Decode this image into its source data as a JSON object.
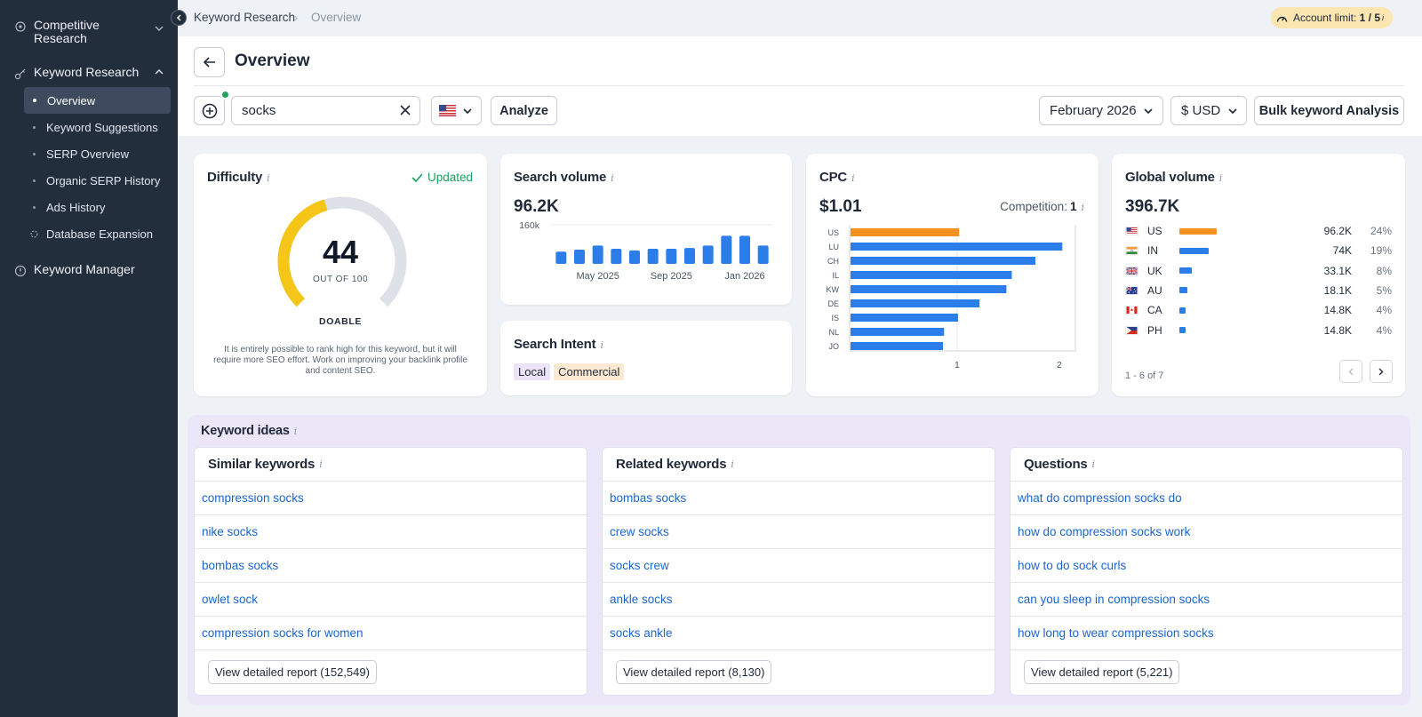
{
  "sidebar": {
    "sections": [
      {
        "label": "Competitive Research",
        "icon": "target-icon"
      },
      {
        "label": "Keyword Research",
        "icon": "key-icon"
      },
      {
        "label": "Keyword Manager",
        "icon": "info-circle-icon"
      }
    ],
    "items": [
      {
        "label": "Overview",
        "active": true
      },
      {
        "label": "Keyword Suggestions"
      },
      {
        "label": "SERP Overview"
      },
      {
        "label": "Organic SERP History"
      },
      {
        "label": "Ads History"
      },
      {
        "label": "Database Expansion"
      }
    ]
  },
  "breadcrumb": {
    "root": "Keyword Research",
    "current": "Overview"
  },
  "account": {
    "label": "Account limit:",
    "value": "1 / 5",
    "info": "i"
  },
  "header": {
    "title": "Overview",
    "search_value": "socks",
    "country": "US",
    "analyze_label": "Analyze",
    "month": "February 2026",
    "currency": "$ USD",
    "bulk_label": "Bulk keyword Analysis"
  },
  "difficulty": {
    "title": "Difficulty",
    "status": "Updated",
    "value": "44",
    "score": 44,
    "out_of": "OUT OF 100",
    "level": "DOABLE",
    "description": "It is entirely possible to rank high for this keyword, but it will require more SEO effort. Work on improving your backlink profile and content SEO."
  },
  "search_volume": {
    "title": "Search volume",
    "value": "96.2K",
    "y_tick": "160k",
    "x_ticks": [
      "May 2025",
      "Sep 2025",
      "Jan 2026"
    ]
  },
  "search_intent": {
    "title": "Search Intent",
    "badges": [
      "Local",
      "Commercial"
    ]
  },
  "cpc": {
    "title": "CPC",
    "value": "$1.01",
    "competition_label": "Competition:",
    "competition_value": "1",
    "x_ticks": [
      "1",
      "2"
    ]
  },
  "global_volume": {
    "title": "Global volume",
    "value": "396.7K",
    "rows": [
      {
        "code": "US",
        "volume": "96.2K",
        "share": "24%",
        "frac": 0.24
      },
      {
        "code": "IN",
        "volume": "74K",
        "share": "19%",
        "frac": 0.19
      },
      {
        "code": "UK",
        "volume": "33.1K",
        "share": "8%",
        "frac": 0.08
      },
      {
        "code": "AU",
        "volume": "18.1K",
        "share": "5%",
        "frac": 0.05
      },
      {
        "code": "CA",
        "volume": "14.8K",
        "share": "4%",
        "frac": 0.04
      },
      {
        "code": "PH",
        "volume": "14.8K",
        "share": "4%",
        "frac": 0.04
      }
    ],
    "pagination": "1 - 6 of 7"
  },
  "keyword_ideas": {
    "title": "Keyword ideas",
    "similar": {
      "title": "Similar keywords",
      "items": [
        "compression socks",
        "nike socks",
        "bombas socks",
        "owlet sock",
        "compression socks for women"
      ],
      "report": "View detailed report (152,549)"
    },
    "related": {
      "title": "Related keywords",
      "items": [
        "bombas socks",
        "crew socks",
        "socks crew",
        "ankle socks",
        "socks ankle"
      ],
      "report": "View detailed report (8,130)"
    },
    "questions": {
      "title": "Questions",
      "items": [
        "what do compression socks do",
        "how do compression socks work",
        "how to do sock curls",
        "can you sleep in compression socks",
        "how long to wear compression socks"
      ],
      "report": "View detailed report (5,221)"
    }
  },
  "chart_data": [
    {
      "type": "bar",
      "title": "Search volume",
      "categories": [
        "Mar 2025",
        "Apr 2025",
        "May 2025",
        "Jun 2025",
        "Jul 2025",
        "Aug 2025",
        "Sep 2025",
        "Oct 2025",
        "Nov 2025",
        "Dec 2025",
        "Jan 2026",
        "Feb 2026"
      ],
      "values": [
        50000,
        58000,
        75000,
        62000,
        55000,
        62000,
        62000,
        65000,
        75000,
        115000,
        115000,
        75000
      ],
      "ylim": [
        0,
        160000
      ],
      "y_tick_labels": [
        "160k"
      ],
      "x_tick_labels": [
        "May 2025",
        "Sep 2025",
        "Jan 2026"
      ],
      "color": "#2b7de9"
    },
    {
      "type": "bar",
      "orientation": "horizontal",
      "title": "CPC",
      "categories": [
        "US",
        "LU",
        "CH",
        "IL",
        "KW",
        "DE",
        "IS",
        "NL",
        "JO"
      ],
      "values": [
        1.01,
        1.97,
        1.72,
        1.5,
        1.45,
        1.2,
        1.0,
        0.87,
        0.86
      ],
      "xlim": [
        0,
        2.1
      ],
      "x_tick_labels": [
        "1",
        "2"
      ],
      "highlight": {
        "category": "US",
        "color": "#f6911f"
      },
      "color": "#2b7de9"
    }
  ],
  "colors": {
    "sidebar": "#232e3d",
    "accent": "#2b7de9",
    "highlight": "#f6911f",
    "gauge": "#f5c518",
    "link": "#1a66d0",
    "success": "#19a35d"
  }
}
